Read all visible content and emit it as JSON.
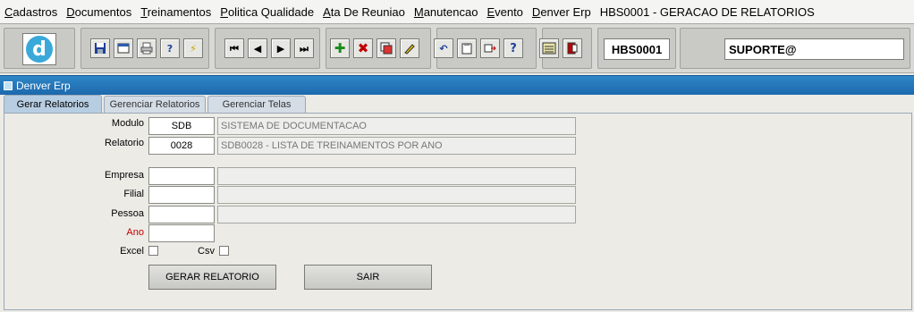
{
  "menu": {
    "items": [
      {
        "underline": "C",
        "rest": "adastros"
      },
      {
        "underline": "D",
        "rest": "ocumentos"
      },
      {
        "underline": "T",
        "rest": "reinamentos"
      },
      {
        "underline": "P",
        "rest": "olitica Qualidade"
      },
      {
        "underline": "A",
        "rest": "ta De Reuniao"
      },
      {
        "underline": "M",
        "rest": "anutencao"
      },
      {
        "underline": "E",
        "rest": "vento"
      },
      {
        "underline": "D",
        "rest": "enver Erp"
      },
      {
        "underline": "",
        "rest": "HBS0001 - GERACAO DE RELATORIOS"
      }
    ]
  },
  "toolbar": {
    "logo_letter": "d",
    "code": "HBS0001",
    "user": "SUPORTE@"
  },
  "window": {
    "title": "Denver Erp"
  },
  "tabs": [
    "Gerar Relatorios",
    "Gerenciar Relatorios",
    "Gerenciar Telas"
  ],
  "form": {
    "modulo_label": "Modulo",
    "modulo_value": "SDB",
    "modulo_desc": "SISTEMA DE DOCUMENTACAO",
    "relatorio_label": "Relatorio",
    "relatorio_value": "0028",
    "relatorio_desc": "SDB0028 - LISTA DE TREINAMENTOS POR ANO",
    "empresa_label": "Empresa",
    "filial_label": "Filial",
    "pessoa_label": "Pessoa",
    "ano_label": "Ano",
    "excel_label": "Excel",
    "csv_label": "Csv"
  },
  "buttons": {
    "gerar": "GERAR RELATORIO",
    "sair": "SAIR"
  },
  "colors": {
    "window_bar": "#2f86c6",
    "required_label": "#c00000",
    "logo": "#3aa9d9"
  }
}
